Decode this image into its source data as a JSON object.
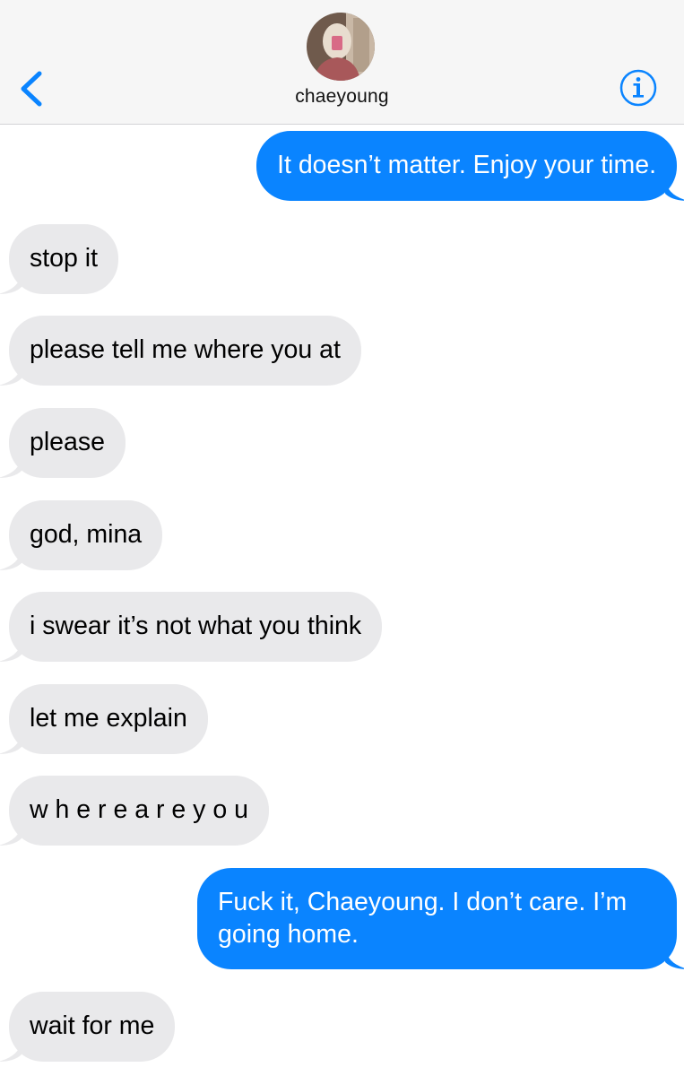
{
  "header": {
    "contact_name": "chaeyoung",
    "back_icon": "chevron-left-icon",
    "info_icon": "info-icon",
    "accent_color": "#0a84ff"
  },
  "messages": [
    {
      "direction": "outgoing",
      "text": "It doesn’t matter. Enjoy your time."
    },
    {
      "direction": "incoming",
      "text": "stop it"
    },
    {
      "direction": "incoming",
      "text": "please tell me where you at"
    },
    {
      "direction": "incoming",
      "text": "please"
    },
    {
      "direction": "incoming",
      "text": "god, mina"
    },
    {
      "direction": "incoming",
      "text": "i swear it’s not what you think"
    },
    {
      "direction": "incoming",
      "text": "let me explain"
    },
    {
      "direction": "incoming",
      "text": "w h e r e a r e y o u"
    },
    {
      "direction": "outgoing",
      "text": "Fuck it, Chaeyoung. I don’t care. I’m going home."
    },
    {
      "direction": "incoming",
      "text": "wait for me"
    }
  ],
  "colors": {
    "outgoing_bubble": "#0a84ff",
    "incoming_bubble": "#e9e9eb",
    "header_bg": "#f6f6f6"
  }
}
